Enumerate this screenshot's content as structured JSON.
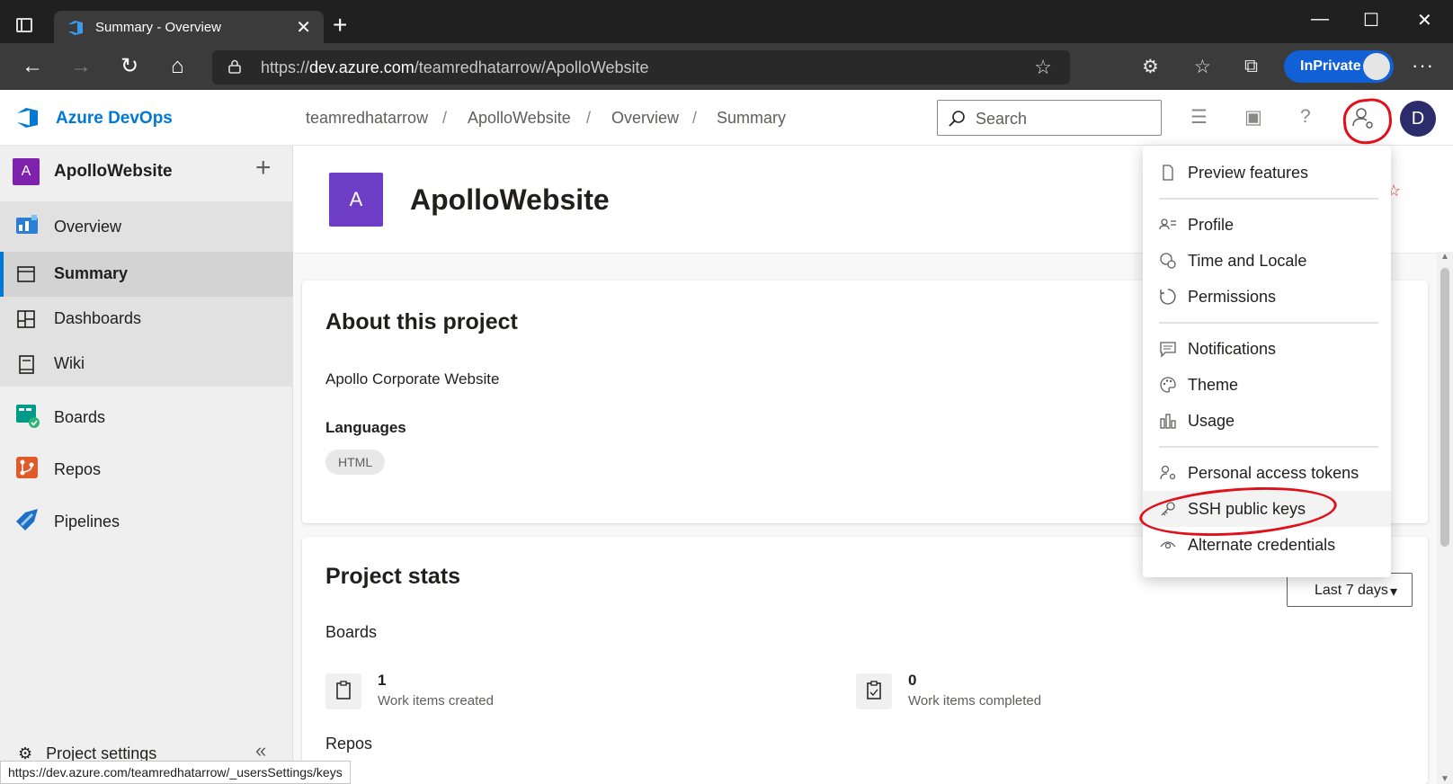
{
  "browser": {
    "tab_title": "Summary - Overview",
    "tab_close": "✕",
    "new_tab": "+",
    "window_controls": {
      "minimize": "—",
      "maximize": "☐",
      "close": "✕"
    },
    "url_prefix": "https://",
    "url_host": "dev.azure.com",
    "url_path": "/teamredhatarrow/ApolloWebsite",
    "inprivate_label": "InPrivate",
    "more_glyph": "···",
    "status_url": "https://dev.azure.com/teamredhatarrow/_usersSettings/keys"
  },
  "header": {
    "brand": "Azure DevOps",
    "breadcrumbs": [
      "teamredhatarrow",
      "ApolloWebsite",
      "Overview",
      "Summary"
    ],
    "crumb_separator": "/",
    "search_placeholder": "Search",
    "user_initial": "D"
  },
  "sidebar": {
    "project_initial": "A",
    "project_name": "ApolloWebsite",
    "add_glyph": "+",
    "items": [
      {
        "label": "Overview",
        "icon": "overview-icon"
      },
      {
        "label": "Summary",
        "icon": "summary-icon"
      },
      {
        "label": "Dashboards",
        "icon": "dashboards-icon"
      },
      {
        "label": "Wiki",
        "icon": "wiki-icon"
      },
      {
        "label": "Boards",
        "icon": "boards-icon"
      },
      {
        "label": "Repos",
        "icon": "repos-icon"
      },
      {
        "label": "Pipelines",
        "icon": "pipelines-icon"
      }
    ],
    "project_settings": "Project settings",
    "collapse_glyph": "«"
  },
  "main": {
    "project_initial": "A",
    "project_title": "ApolloWebsite",
    "about": {
      "title": "About this project",
      "description": "Apollo Corporate Website",
      "languages_label": "Languages",
      "language_tag": "HTML"
    },
    "stats": {
      "title": "Project stats",
      "range_label": "Last 7 days",
      "boards_label": "Boards",
      "created_count": "1",
      "created_label": "Work items created",
      "completed_count": "0",
      "completed_label": "Work items completed",
      "repos_label": "Repos"
    }
  },
  "user_menu": {
    "items": [
      {
        "label": "Preview features",
        "icon": "document-icon"
      },
      {
        "label": "Profile",
        "icon": "profile-icon"
      },
      {
        "label": "Time and Locale",
        "icon": "globe-clock-icon"
      },
      {
        "label": "Permissions",
        "icon": "refresh-icon"
      },
      {
        "label": "Notifications",
        "icon": "chat-icon"
      },
      {
        "label": "Theme",
        "icon": "palette-icon"
      },
      {
        "label": "Usage",
        "icon": "bar-chart-icon"
      },
      {
        "label": "Personal access tokens",
        "icon": "person-key-icon"
      },
      {
        "label": "SSH public keys",
        "icon": "key-icon"
      },
      {
        "label": "Alternate credentials",
        "icon": "eye-icon"
      }
    ]
  },
  "colors": {
    "accent": "#0078d4",
    "annotation": "#e0101a",
    "project_badge": "#7e22ae",
    "avatar": "#2c2c6c",
    "inprivate": "#1160d6"
  }
}
